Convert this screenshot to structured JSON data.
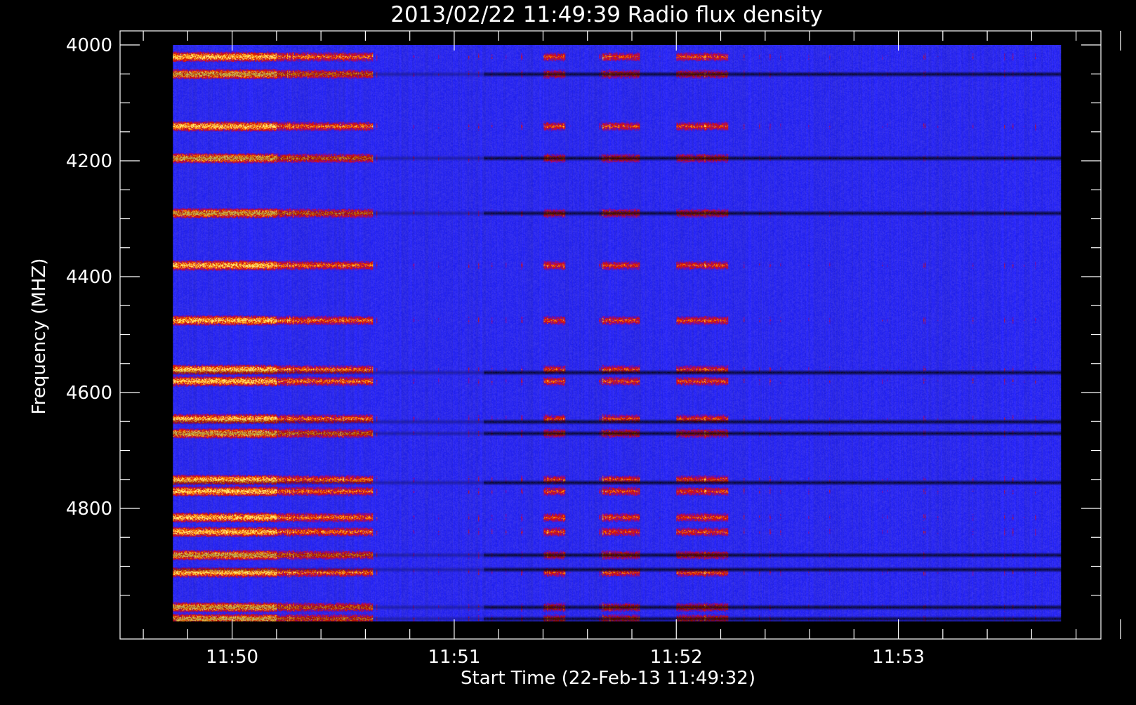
{
  "chart_data": {
    "type": "heatmap",
    "title": "2013/02/22 11:49:39 Radio flux density",
    "xlabel": "Start Time (22-Feb-13 11:49:32)",
    "ylabel": "Frequency (MHZ)",
    "x_range_seconds": [
      0,
      306
    ],
    "y_range_mhz": [
      4000,
      5000
    ],
    "x_ticks": [
      {
        "label": "11:50",
        "seconds": 28
      },
      {
        "label": "11:51",
        "seconds": 88
      },
      {
        "label": "11:52",
        "seconds": 148
      },
      {
        "label": "11:53",
        "seconds": 208
      }
    ],
    "y_ticks": [
      {
        "label": "4000",
        "mhz": 4000
      },
      {
        "label": "4200",
        "mhz": 4200
      },
      {
        "label": "4400",
        "mhz": 4400
      },
      {
        "label": "4600",
        "mhz": 4600
      },
      {
        "label": "4800",
        "mhz": 4800
      }
    ],
    "data_time_range_seconds": [
      12,
      252
    ],
    "data_freq_range_mhz": [
      4000,
      4995
    ],
    "colorscale": [
      "#000000",
      "#2020f0",
      "#3a38ff",
      "#c00000",
      "#ff2000",
      "#ff9000",
      "#ffff80"
    ],
    "bright_band_centers_mhz": [
      4020,
      4050,
      4140,
      4195,
      4290,
      4380,
      4475,
      4560,
      4580,
      4645,
      4670,
      4750,
      4770,
      4815,
      4840,
      4880,
      4910,
      4970,
      4990
    ],
    "dark_band_centers_mhz": [
      4050,
      4195,
      4290,
      4565,
      4650,
      4670,
      4755,
      4880,
      4905,
      4970,
      4990
    ],
    "activity_seconds": [
      [
        12,
        40
      ],
      [
        40,
        66
      ],
      [
        112,
        118
      ],
      [
        128,
        138
      ],
      [
        148,
        162
      ]
    ],
    "grid": false
  }
}
